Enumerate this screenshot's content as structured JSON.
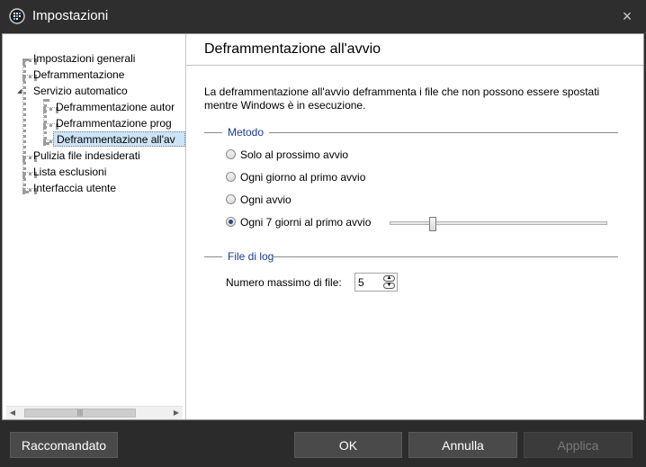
{
  "window": {
    "title": "Impostazioni",
    "close_glyph": "×",
    "icon": "app-logo-icon"
  },
  "tree": {
    "items": [
      {
        "label": "Impostazioni generali"
      },
      {
        "label": "Deframmentazione"
      },
      {
        "label": "Servizio automatico",
        "expanded": true
      },
      {
        "label": "Deframmentazione autor"
      },
      {
        "label": "Deframmentazione prog"
      },
      {
        "label": "Deframmentazione all'av",
        "selected": true
      },
      {
        "label": "Pulizia file indesiderati"
      },
      {
        "label": "Lista esclusioni"
      },
      {
        "label": "Interfaccia utente"
      }
    ],
    "expand_glyph": "◢",
    "scroll_left": "◀",
    "scroll_right": "▶",
    "scroll_grip": "|||"
  },
  "panel": {
    "title": "Deframmentazione all'avvio",
    "description": "La deframmentazione all'avvio deframmenta i file che non possono essere spostati mentre Windows è in esecuzione.",
    "method_group": {
      "heading": "Metodo",
      "options": [
        {
          "label": "Solo al prossimo avvio",
          "selected": false
        },
        {
          "label": "Ogni giorno al primo avvio",
          "selected": false
        },
        {
          "label": "Ogni avvio",
          "selected": false
        },
        {
          "label": "Ogni 7 giorni al primo avvio",
          "selected": true
        }
      ],
      "days_slider_fraction": 0.19
    },
    "log_group": {
      "heading": "File di log",
      "max_files_label": "Numero massimo di file:",
      "max_files_value": "5"
    }
  },
  "footer": {
    "recommended_label": "Raccomandato",
    "ok_label": "OK",
    "cancel_label": "Annulla",
    "apply_label": "Applica"
  },
  "colors": {
    "frame": "#2e2e2e",
    "group_heading": "#1a3c8c",
    "selection": "#cce4f7"
  }
}
